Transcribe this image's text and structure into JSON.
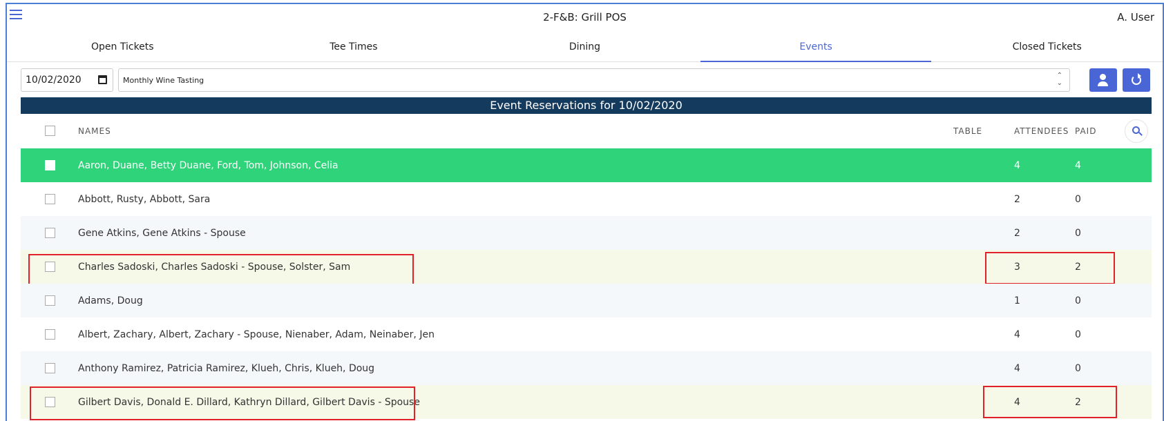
{
  "app": {
    "title": "2-F&B: Grill POS",
    "user": "A. User"
  },
  "tabs": [
    {
      "label": "Open Tickets",
      "active": false
    },
    {
      "label": "Tee Times",
      "active": false
    },
    {
      "label": "Dining",
      "active": false
    },
    {
      "label": "Events",
      "active": true
    },
    {
      "label": "Closed Tickets",
      "active": false
    }
  ],
  "controls": {
    "date": "10/02/2020",
    "event": "Monthly Wine Tasting"
  },
  "table": {
    "banner": "Event Reservations for 10/02/2020",
    "headers": {
      "names": "NAMES",
      "table": "TABLE",
      "attendees": "ATTENDEES",
      "paid": "PAID"
    },
    "rows": [
      {
        "names": "Aaron, Duane, Betty Duane, Ford, Tom, Johnson, Celia",
        "table": "",
        "attendees": "4",
        "paid": "4"
      },
      {
        "names": "Abbott, Rusty, Abbott, Sara",
        "table": "",
        "attendees": "2",
        "paid": "0"
      },
      {
        "names": "Gene Atkins, Gene Atkins - Spouse",
        "table": "",
        "attendees": "2",
        "paid": "0"
      },
      {
        "names": "Charles Sadoski, Charles Sadoski - Spouse, Solster, Sam",
        "table": "",
        "attendees": "3",
        "paid": "2"
      },
      {
        "names": "Adams, Doug",
        "table": "",
        "attendees": "1",
        "paid": "0"
      },
      {
        "names": "Albert, Zachary, Albert, Zachary - Spouse, Nienaber, Adam, Neinaber, Jen",
        "table": "",
        "attendees": "4",
        "paid": "0"
      },
      {
        "names": "Anthony Ramirez, Patricia Ramirez, Klueh, Chris, Klueh, Doug",
        "table": "",
        "attendees": "4",
        "paid": "0"
      },
      {
        "names": "Gilbert Davis, Donald E. Dillard, Kathryn Dillard, Gilbert Davis - Spouse",
        "table": "",
        "attendees": "4",
        "paid": "2"
      }
    ]
  },
  "colors": {
    "accent": "#4a66d6",
    "banner": "#143a5e",
    "selected_row": "#2ed37a",
    "highlight_row": "#f6f8e8",
    "annotation": "#e0202a"
  }
}
